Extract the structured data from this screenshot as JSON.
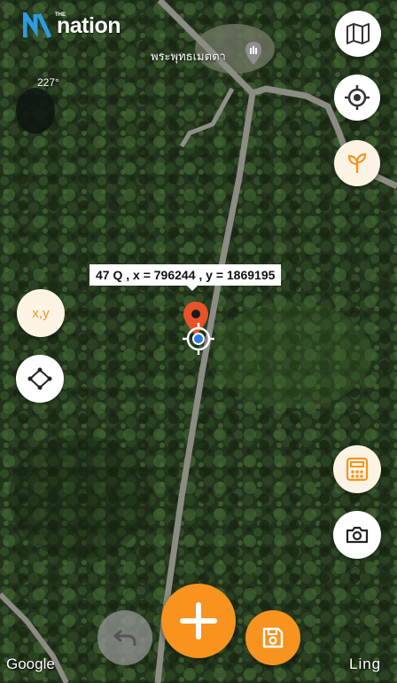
{
  "brand": {
    "logo_small": "THE",
    "logo_word": "nation"
  },
  "map": {
    "heading_label": "227°",
    "poi_label": "พระพุทธเมตตา",
    "coordinate_label": "47 Q , x = 796244 , y = 1869195",
    "attribution": "Google",
    "watermark": "Ling"
  },
  "controls": {
    "xy_button_label": "x,y",
    "map_layers_icon": "map-icon",
    "locate_icon": "crosshair-target-icon",
    "plant_icon": "sprout-icon",
    "shape_icon": "diamond-polygon-icon",
    "calculator_icon": "calculator-icon",
    "camera_icon": "camera-icon",
    "undo_icon": "undo-icon",
    "add_icon": "plus-icon",
    "save_icon": "save-icon"
  },
  "colors": {
    "accent": "#f7931e",
    "pin": "#e8532a",
    "location_dot": "#2e7be0"
  }
}
